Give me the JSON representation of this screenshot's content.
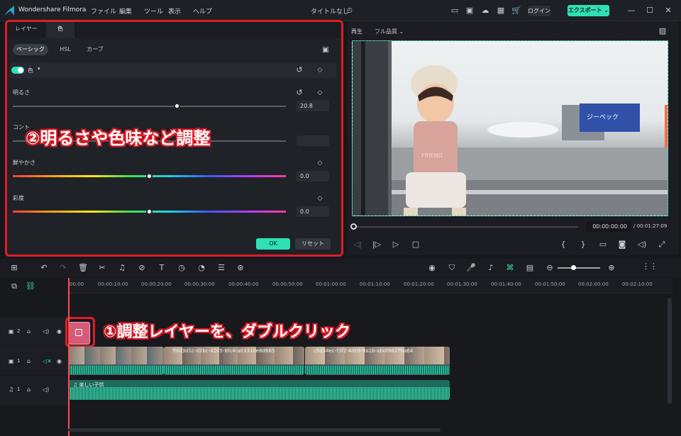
{
  "app": {
    "title": "Wondershare Filmora",
    "document": "タイトルなし"
  },
  "menu": [
    "ファイル",
    "編集",
    "ツール",
    "表示",
    "ヘルプ"
  ],
  "header": {
    "login_label": "ログイン",
    "export_label": "エクスポート"
  },
  "panel": {
    "tabs": [
      "レイヤー",
      "色"
    ],
    "subtabs": [
      "ベーシック",
      "HSL",
      "カーブ"
    ],
    "section_label": "色",
    "sliders": [
      {
        "label": "明るさ",
        "value": "20.8",
        "fraction": 0.56
      },
      {
        "label": "コント",
        "value": "",
        "fraction": 0.5
      },
      {
        "label": "鮮やかさ",
        "value": "0.0",
        "fraction": 0.5
      },
      {
        "label": "彩度",
        "value": "0.0",
        "fraction": 0.5
      }
    ],
    "ok_label": "OK",
    "reset_label": "リセット"
  },
  "preview": {
    "play_label": "再生",
    "quality": "フル品質",
    "current_time": "00:00:00:00",
    "total_time": "/ 00:01:27:09"
  },
  "annotations": {
    "step1": "①調整レイヤーを、ダブルクリック",
    "step2": "②明るさや色味など調整"
  },
  "ruler": [
    "00:00",
    "00:00:10:00",
    "00:00:20:00",
    "00:00:30:00",
    "00:00:40:00",
    "00:00:50:00",
    "00:01:00:00",
    "00:01:10:00",
    "00:01:20:00",
    "00:01:30:00",
    "00:01:40:00",
    "00:01:50:00",
    "00:02:00:00",
    "00:02:10:00"
  ],
  "tracks": {
    "video1_label": "2",
    "video2_label": "1",
    "audio_label": "1",
    "clip_names": [
      "ff8d3d1c-d2bc-4205-8fc4-a03310e8d665",
      "c6d34ec-f3f2-4db9-8a1b-abdf8627ba64"
    ],
    "audio_name": "楽しい子供"
  },
  "colors": {
    "accent": "#2ee0b4",
    "annotation_red": "#e01c28",
    "playhead": "#ff4a4a"
  }
}
